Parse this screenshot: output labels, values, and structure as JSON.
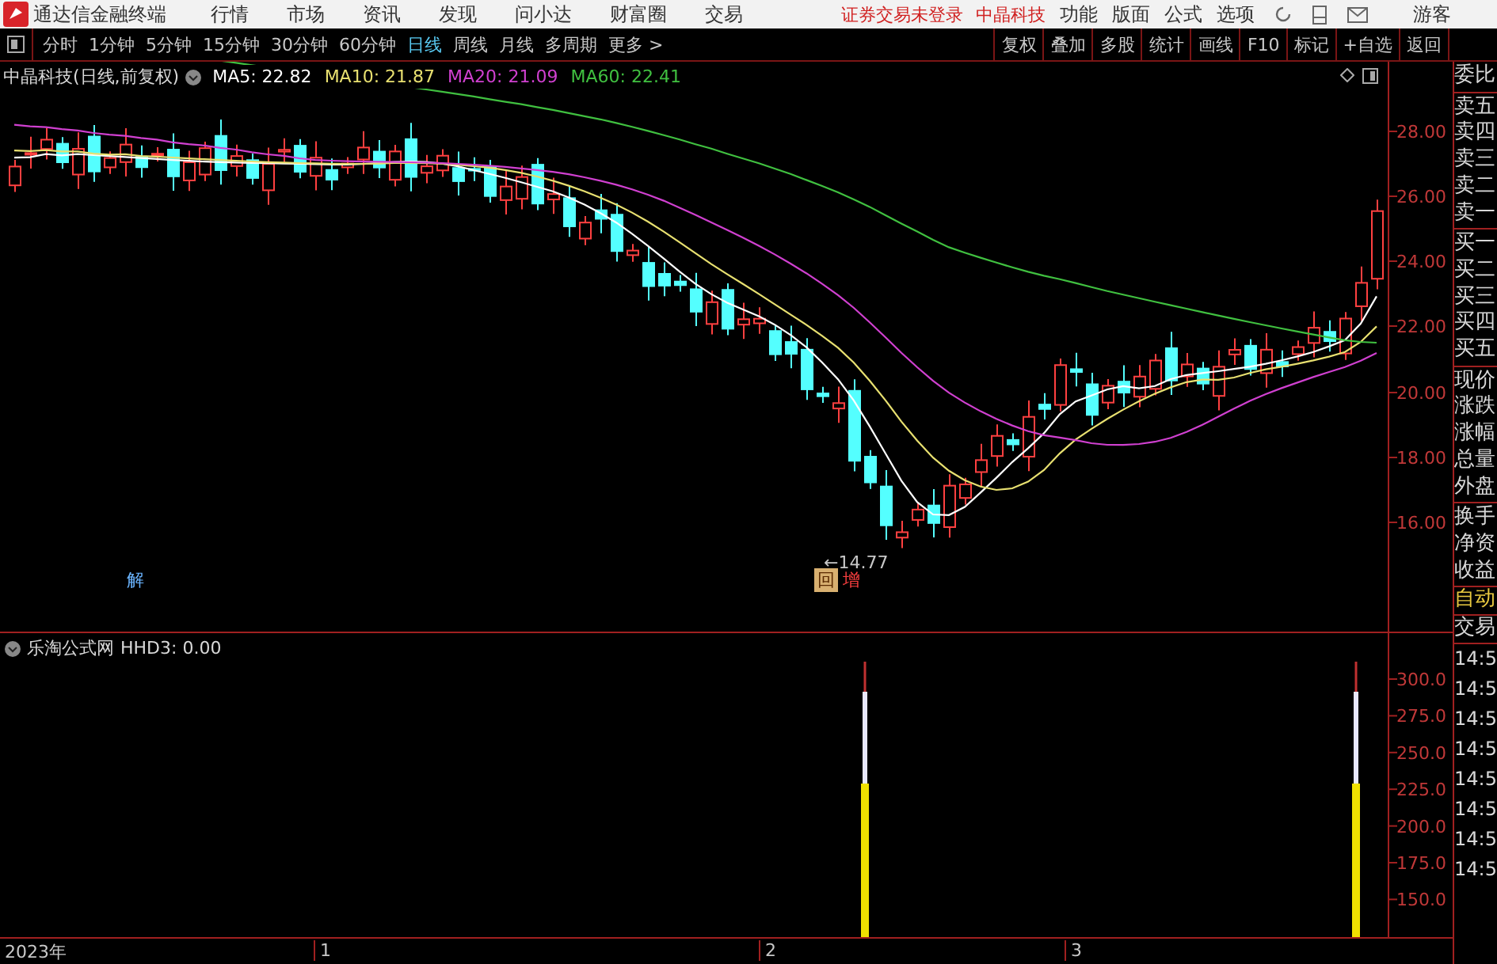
{
  "app_menu": {
    "title": "通达信金融终端",
    "items": [
      "行情",
      "市场",
      "资讯",
      "发现",
      "问小达",
      "财富圈",
      "交易"
    ],
    "notice": "证券交易未登录",
    "stock": "中晶科技",
    "right_items": [
      "功能",
      "版面",
      "公式",
      "选项"
    ],
    "user": "游客"
  },
  "periods": [
    {
      "label": "分时",
      "selected": false
    },
    {
      "label": "1分钟",
      "selected": false
    },
    {
      "label": "5分钟",
      "selected": false
    },
    {
      "label": "15分钟",
      "selected": false
    },
    {
      "label": "30分钟",
      "selected": false
    },
    {
      "label": "60分钟",
      "selected": false
    },
    {
      "label": "日线",
      "selected": true
    },
    {
      "label": "周线",
      "selected": false
    },
    {
      "label": "月线",
      "selected": false
    },
    {
      "label": "多周期",
      "selected": false
    },
    {
      "label": "更多 >",
      "selected": false
    }
  ],
  "tool_buttons": [
    "复权",
    "叠加",
    "多股",
    "统计",
    "画线",
    "F10",
    "标记",
    "+自选",
    "返回"
  ],
  "main_chart": {
    "title": "中晶科技(日线,前复权)",
    "ma": [
      {
        "label": "MA5: 22.82",
        "color": "#ffffff"
      },
      {
        "label": "MA10: 21.87",
        "color": "#e8e070"
      },
      {
        "label": "MA20: 21.09",
        "color": "#d040d0"
      },
      {
        "label": "MA60: 22.41",
        "color": "#40c040"
      }
    ],
    "y_ticks": [
      "28.00",
      "26.00",
      "24.00",
      "22.00",
      "20.00",
      "18.00",
      "16.00"
    ],
    "low_marker": "←14.77",
    "unlock_mark": "解",
    "signals": [
      {
        "text": "回",
        "kind": "boxed"
      },
      {
        "text": "增",
        "kind": "plain"
      }
    ]
  },
  "indicator": {
    "title": "乐淘公式网",
    "value": "HHD3: 0.00",
    "y_ticks": [
      "300.0",
      "275.0",
      "250.0",
      "225.0",
      "200.0",
      "175.0",
      "150.0"
    ]
  },
  "x_axis": [
    "2023年",
    "1",
    "2",
    "3"
  ],
  "quote_panel": {
    "groups": [
      [
        "委比"
      ],
      [
        "卖五",
        "卖四",
        "卖三",
        "卖二",
        "卖一"
      ],
      [
        "买一",
        "买二",
        "买三",
        "买四",
        "买五"
      ],
      [
        "现价",
        "涨跌",
        "涨幅",
        "总量",
        "外盘"
      ],
      [
        "换手",
        "净资",
        "收益"
      ]
    ],
    "mode": "自动",
    "trade": "交易",
    "times": [
      "14:5",
      "14:5",
      "14:5",
      "14:5",
      "14:5",
      "14:5",
      "14:5",
      "14:5"
    ]
  }
}
